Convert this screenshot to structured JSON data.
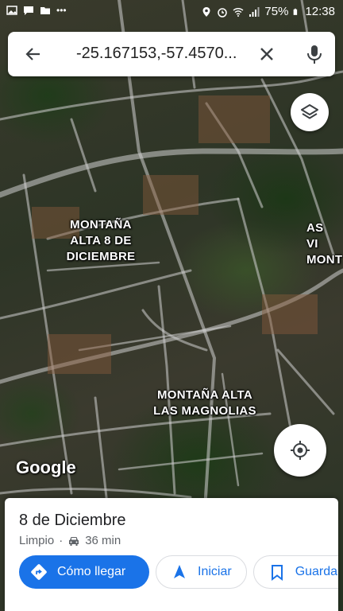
{
  "status_bar": {
    "battery": "75%",
    "time": "12:38"
  },
  "search": {
    "query": "-25.167153,-57.4570..."
  },
  "map": {
    "labels": [
      {
        "text": "MONTAÑA\nALTA 8 DE\nDICIEMBRE"
      },
      {
        "text": "MONTAÑA ALTA\nLAS MAGNOLIAS"
      },
      {
        "text": "AS\nVI\nMONT"
      }
    ],
    "attribution": "Google"
  },
  "place_sheet": {
    "name": "8 de Diciembre",
    "weather": "Limpio",
    "separator": "·",
    "drive_time": "36 min",
    "actions": {
      "directions": "Cómo llegar",
      "start": "Iniciar",
      "save": "Guardar"
    }
  },
  "colors": {
    "accent": "#1a73e8",
    "road": "#c9c9c9"
  },
  "icons": [
    "back-arrow-icon",
    "close-icon",
    "microphone-icon",
    "layers-icon",
    "my-location-icon",
    "car-icon",
    "directions-icon",
    "navigation-arrow-icon",
    "bookmark-icon"
  ]
}
